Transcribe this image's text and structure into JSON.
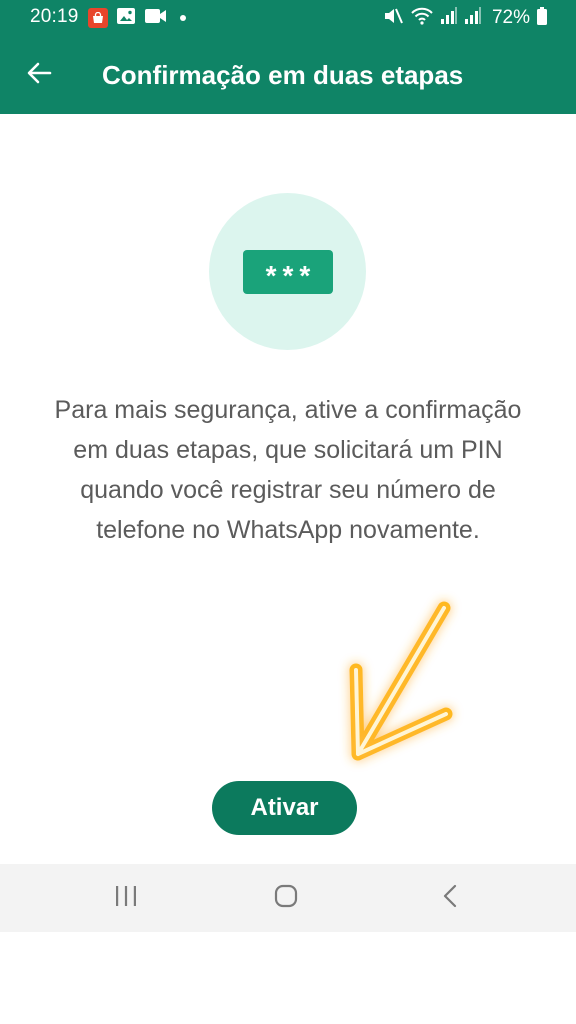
{
  "colors": {
    "brand": "#0f8466",
    "button": "#0c7a5d",
    "pin_box": "#1aa37a",
    "circle": "#dcf5ee",
    "text": "#5b5b5b",
    "highlight_arrow": "#ffb400"
  },
  "status_bar": {
    "time": "20:19",
    "battery": "72%",
    "left_icons": [
      "shopping-app-icon",
      "gallery-icon",
      "video-camera-icon",
      "dot-icon"
    ],
    "right_icons": [
      "mute-icon",
      "wifi-icon",
      "signal-icon",
      "signal-icon",
      "battery-icon"
    ]
  },
  "app_bar": {
    "title": "Confirmação em duas etapas",
    "back_icon": "arrow-back-icon"
  },
  "hero": {
    "pin_text": "***"
  },
  "description": "Para mais segurança, ative a confirmação em duas etapas, que solicitará um PIN quando você registrar seu número de telefone no WhatsApp novamente.",
  "actions": {
    "activate_label": "Ativar"
  },
  "nav_bar": {
    "icons": [
      "recents-icon",
      "home-icon",
      "back-icon"
    ]
  }
}
